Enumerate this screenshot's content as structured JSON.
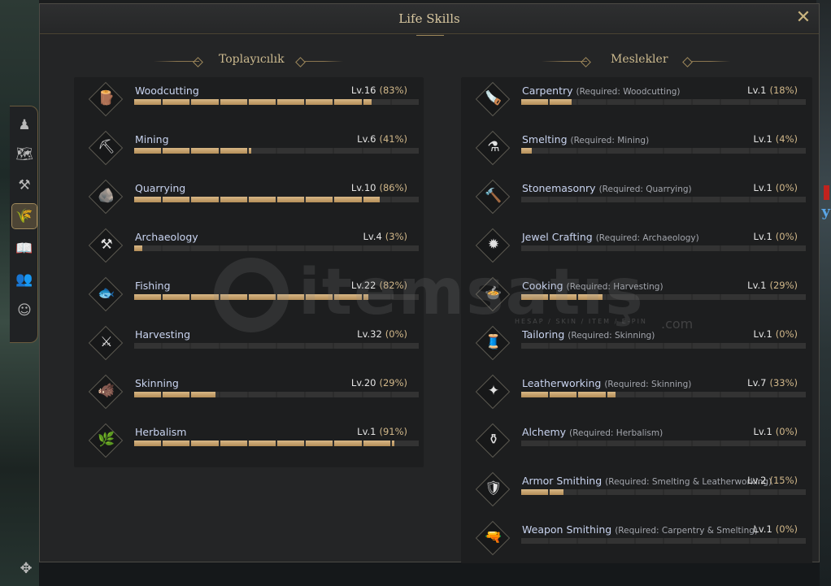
{
  "window": {
    "title": "Life Skills"
  },
  "gathering": {
    "title": "Toplayıcılık",
    "skills": [
      {
        "name": "Woodcutting",
        "icon": "log-icon",
        "glyph": "🪵",
        "level": "Lv.16",
        "percent": "(83%)",
        "fill": 0.83
      },
      {
        "name": "Mining",
        "icon": "pickaxe-icon",
        "glyph": "⛏",
        "level": "Lv.6",
        "percent": "(41%)",
        "fill": 0.41
      },
      {
        "name": "Quarrying",
        "icon": "stone-icon",
        "glyph": "🪨",
        "level": "Lv.10",
        "percent": "(86%)",
        "fill": 0.86
      },
      {
        "name": "Archaeology",
        "icon": "shovel-icon",
        "glyph": "⚒",
        "level": "Lv.4",
        "percent": "(3%)",
        "fill": 0.03
      },
      {
        "name": "Fishing",
        "icon": "fish-icon",
        "glyph": "🐟",
        "level": "Lv.22",
        "percent": "(82%)",
        "fill": 0.82
      },
      {
        "name": "Harvesting",
        "icon": "sickle-icon",
        "glyph": "⚔",
        "level": "Lv.32",
        "percent": "(0%)",
        "fill": 0.0
      },
      {
        "name": "Skinning",
        "icon": "boar-icon",
        "glyph": "🐗",
        "level": "Lv.20",
        "percent": "(29%)",
        "fill": 0.29
      },
      {
        "name": "Herbalism",
        "icon": "herb-icon",
        "glyph": "🌿",
        "level": "Lv.1",
        "percent": "(91%)",
        "fill": 0.91
      }
    ]
  },
  "professions": {
    "title": "Meslekler",
    "skills": [
      {
        "name": "Carpentry",
        "req": "(Required: Woodcutting)",
        "icon": "saw-icon",
        "glyph": "🪚",
        "level": "Lv.1",
        "percent": "(18%)",
        "fill": 0.18
      },
      {
        "name": "Smelting",
        "req": "(Required: Mining)",
        "icon": "furnace-icon",
        "glyph": "⚗",
        "level": "Lv.1",
        "percent": "(4%)",
        "fill": 0.04
      },
      {
        "name": "Stonemasonry",
        "req": "(Required: Quarrying)",
        "icon": "hammer-icon",
        "glyph": "🔨",
        "level": "Lv.1",
        "percent": "(0%)",
        "fill": 0.0
      },
      {
        "name": "Jewel Crafting",
        "req": "(Required: Archaeology)",
        "icon": "gem-ring-icon",
        "glyph": "✹",
        "level": "Lv.1",
        "percent": "(0%)",
        "fill": 0.0
      },
      {
        "name": "Cooking",
        "req": "(Required: Harvesting)",
        "icon": "pot-icon",
        "glyph": "🍲",
        "level": "Lv.1",
        "percent": "(29%)",
        "fill": 0.29
      },
      {
        "name": "Tailoring",
        "req": "(Required: Skinning)",
        "icon": "needle-thread-icon",
        "glyph": "🧵",
        "level": "Lv.1",
        "percent": "(0%)",
        "fill": 0.0
      },
      {
        "name": "Leatherworking",
        "req": "(Required: Skinning)",
        "icon": "hide-icon",
        "glyph": "✦",
        "level": "Lv.7",
        "percent": "(33%)",
        "fill": 0.33
      },
      {
        "name": "Alchemy",
        "req": "(Required: Herbalism)",
        "icon": "mortar-icon",
        "glyph": "⚱",
        "level": "Lv.1",
        "percent": "(0%)",
        "fill": 0.0
      },
      {
        "name": "Armor Smithing",
        "req": "(Required: Smelting & Leatherworking)",
        "icon": "armor-icon",
        "glyph": "🛡",
        "level": "Lv.2",
        "percent": "(15%)",
        "fill": 0.15
      },
      {
        "name": "Weapon Smithing",
        "req": "(Required: Carpentry & Smelting)",
        "icon": "gun-icon",
        "glyph": "🔫",
        "level": "Lv.1",
        "percent": "(0%)",
        "fill": 0.0
      }
    ]
  },
  "side_tabs": [
    {
      "icon": "character-icon",
      "glyph": "♟",
      "active": false
    },
    {
      "icon": "map-icon",
      "glyph": "🗺",
      "active": false
    },
    {
      "icon": "anvil-icon",
      "glyph": "⚒",
      "active": false
    },
    {
      "icon": "life-skills-icon",
      "glyph": "🌾",
      "active": true
    },
    {
      "icon": "book-icon",
      "glyph": "📖",
      "active": false
    },
    {
      "icon": "social-icon",
      "glyph": "👥",
      "active": false
    },
    {
      "icon": "emote-icon",
      "glyph": "☺",
      "active": false
    }
  ],
  "watermark": {
    "text": "itemsatış",
    "sub": "HESAP / SKIN / ITEM / E-PIN",
    "com": ".com"
  },
  "colors": {
    "bar_fill": "#c9a56c",
    "bar_empty": "#333333",
    "accent": "#d8c7a0",
    "name": "#c9d4f0"
  }
}
